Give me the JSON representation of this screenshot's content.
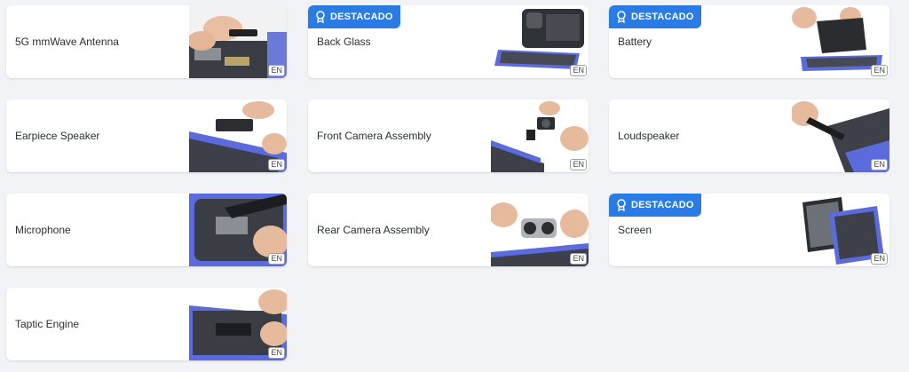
{
  "badge_label": "DESTACADO",
  "lang_label": "EN",
  "guides": [
    {
      "title": "5G mmWave Antenna",
      "featured": false
    },
    {
      "title": "Back Glass",
      "featured": true
    },
    {
      "title": "Battery",
      "featured": true
    },
    {
      "title": "Earpiece Speaker",
      "featured": false
    },
    {
      "title": "Front Camera Assembly",
      "featured": false
    },
    {
      "title": "Loudspeaker",
      "featured": false
    },
    {
      "title": "Microphone",
      "featured": false
    },
    {
      "title": "Rear Camera Assembly",
      "featured": false
    },
    {
      "title": "Screen",
      "featured": true
    },
    {
      "title": "Taptic Engine",
      "featured": false
    }
  ]
}
